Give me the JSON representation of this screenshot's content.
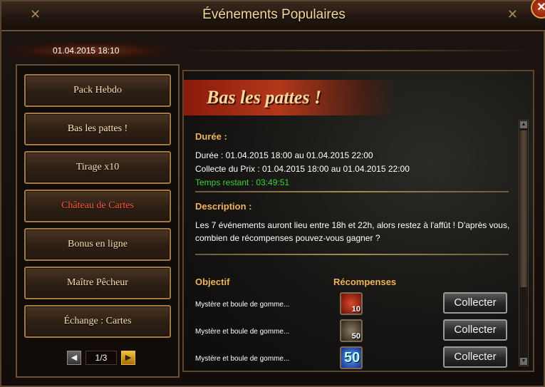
{
  "window": {
    "title": "Événements Populaires",
    "close_label": "✕"
  },
  "date": "01.04.2015 18:10",
  "menu": [
    {
      "label": "Pack Hebdo"
    },
    {
      "label": "Bas les pattes !"
    },
    {
      "label": "Tirage x10"
    },
    {
      "label": "Château de Cartes"
    },
    {
      "label": "Bonus en ligne"
    },
    {
      "label": "Maître Pêcheur"
    },
    {
      "label": "Échange : Cartes"
    }
  ],
  "pager": {
    "page": "1/3",
    "prev_icon": "chevron-left-icon",
    "next_icon": "chevron-right-icon"
  },
  "event": {
    "banner": "Bas les pattes !",
    "duration_heading": "Durée :",
    "duration_line": "Durée : 01.04.2015 18:00 au 01.04.2015 22:00",
    "collect_line": "Collecte du Prix : 01.04.2015 18:00 au 01.04.2015 22:00",
    "remaining": "Temps restant : 03:49:51",
    "description_heading": "Description :",
    "description": "Les 7 événements auront lieu entre 18h et 22h, alors restez à l'affût ! D'après vous, combien de récompenses pouvez-vous gagner ?",
    "objective_heading": "Objectif",
    "rewards_heading": "Récompenses",
    "rows": [
      {
        "objective": "Mystère et boule de gomme...",
        "reward_count": "10",
        "button": "Collecter"
      },
      {
        "objective": "Mystère et boule de gomme...",
        "reward_count": "50",
        "button": "Collecter"
      },
      {
        "objective": "Mystère et boule de gomme...",
        "reward_count": "50",
        "button": "Collecter"
      }
    ]
  },
  "colors": {
    "heading": "#f0b15a",
    "remaining": "#39d23c",
    "active_menu_text": "#ff5a3c"
  }
}
